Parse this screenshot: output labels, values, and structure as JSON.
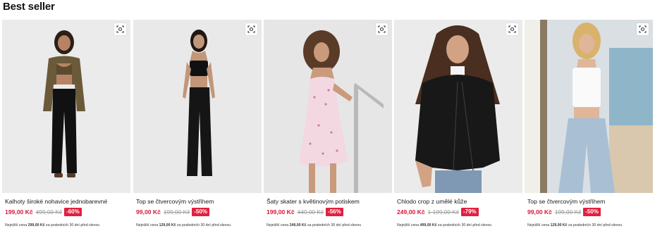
{
  "section": {
    "title": "Best seller"
  },
  "note": {
    "prefix": "Nejnižší cena",
    "suffix": "za posledních 30 dní před slevou"
  },
  "products": [
    {
      "name": "Kalhoty široké nohavice jednobarevné",
      "price": "199,00 Kč",
      "old_price": "499,00 Kč",
      "discount": "-60%",
      "lowest_price": "299,00 Kč",
      "image_icon": "image-search-icon"
    },
    {
      "name": "Top se čtvercovým výstřihem",
      "price": "99,00 Kč",
      "old_price": "199,00 Kč",
      "discount": "-50%",
      "lowest_price": "129,00 Kč",
      "image_icon": "image-search-icon"
    },
    {
      "name": "Šaty skater s květinovým potiskem",
      "price": "199,00 Kč",
      "old_price": "449,00 Kč",
      "discount": "-56%",
      "lowest_price": "249,00 Kč",
      "image_icon": "image-search-icon"
    },
    {
      "name": "Chlodo crop z umělé kůže",
      "price": "249,00 Kč",
      "old_price": "1 199,00 Kč",
      "discount": "-79%",
      "lowest_price": "499,00 Kč",
      "image_icon": "image-search-icon"
    },
    {
      "name": "Top se čtvercovým výstřihem",
      "price": "99,00 Kč",
      "old_price": "199,00 Kč",
      "discount": "-50%",
      "lowest_price": "129,00 Kč",
      "image_icon": "image-search-icon"
    }
  ],
  "colors": {
    "price_red": "#d9163a",
    "badge_red": "#e0213f",
    "old_price_grey": "#9a9a9a"
  }
}
